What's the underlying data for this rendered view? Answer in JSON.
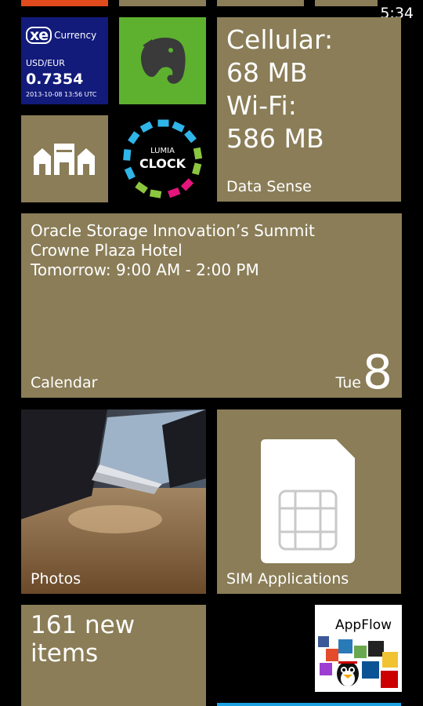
{
  "status_bar": {
    "time": "5:34"
  },
  "tiles": {
    "xe_currency": {
      "logo": "xe",
      "name": "Currency",
      "pair": "USD/EUR",
      "rate": "0.7354",
      "timestamp": "2013-10-08 13:56 UTC"
    },
    "evernote": {
      "icon": "elephant-icon"
    },
    "data_sense": {
      "lines": [
        "Cellular:",
        "68 MB",
        "Wi-Fi:",
        "586 MB"
      ],
      "label": "Data Sense"
    },
    "houses": {
      "icon": "houses-icon"
    },
    "lumia_clock": {
      "line1": "LUMIA",
      "line2": "CLOCK"
    },
    "calendar": {
      "event_lines": [
        "Oracle Storage Innovation’s Summit",
        "Crowne Plaza Hotel",
        "Tomorrow: 9:00 AM - 2:00 PM"
      ],
      "label": "Calendar",
      "weekday": "Tue",
      "date": "8"
    },
    "photos": {
      "label": "Photos"
    },
    "sim": {
      "label": "SIM Applications",
      "icon": "sim-card-icon"
    },
    "new_items": {
      "text": "161 new items"
    },
    "appflow": {
      "title": "AppFlow"
    }
  },
  "colors": {
    "tile_accent": "#8a7d57",
    "xe_blue": "#121a7a",
    "evernote_green": "#5db12f",
    "strip_blue": "#1ba1e2",
    "stub_orange": "#e04a1c"
  }
}
